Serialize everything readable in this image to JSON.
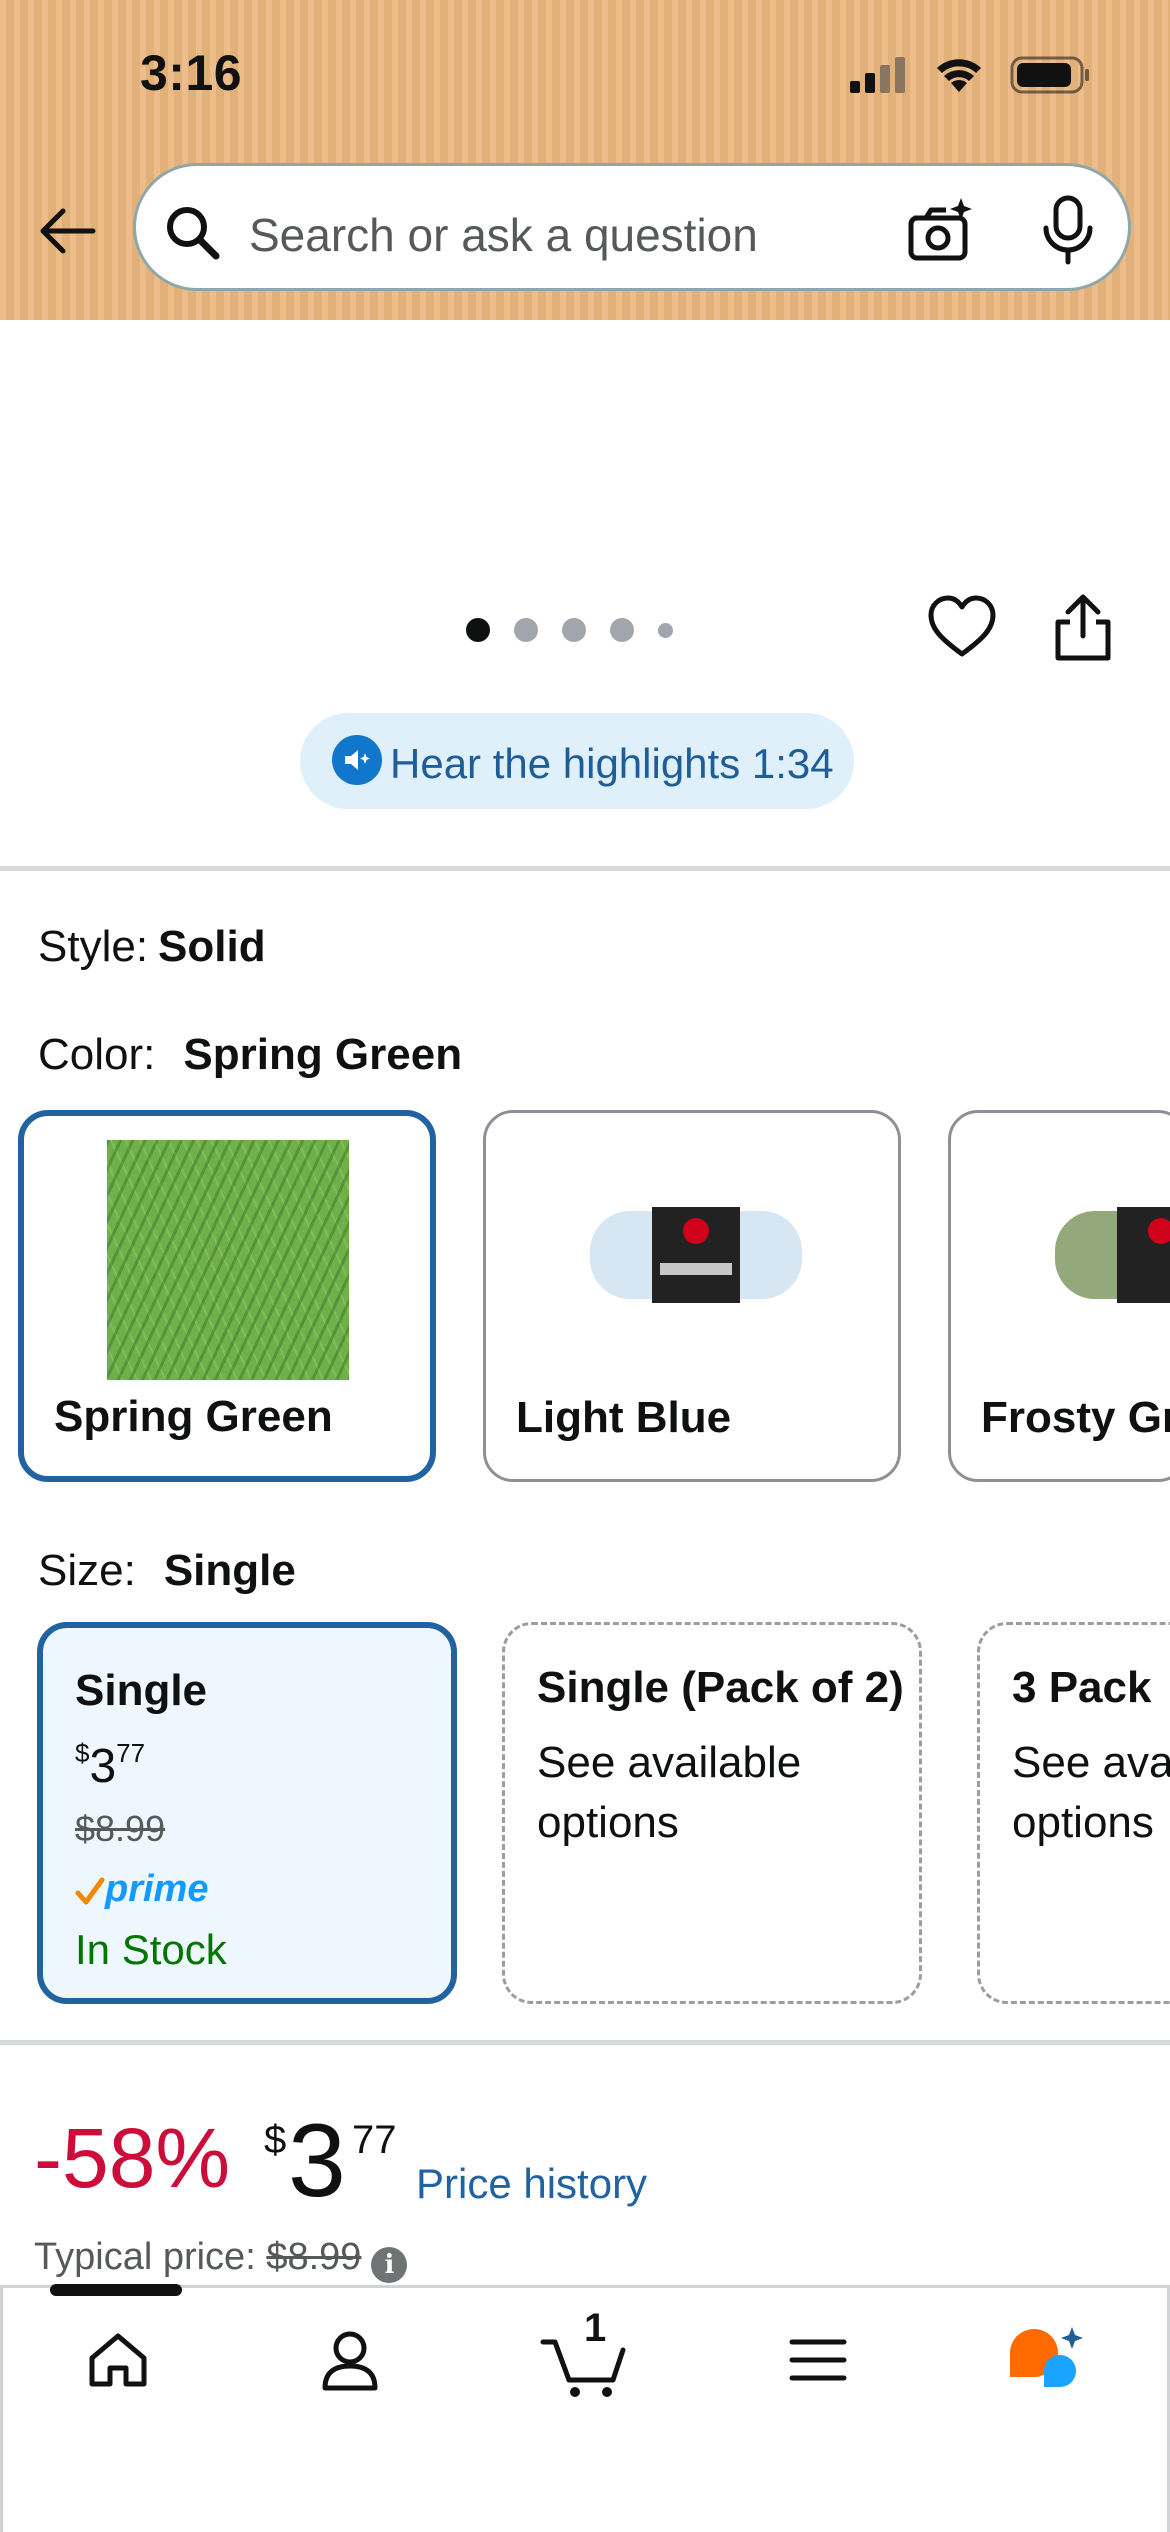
{
  "status_bar": {
    "time": "3:16"
  },
  "search": {
    "placeholder": "Search or ask a question"
  },
  "gallery": {
    "dot_count": 5,
    "active_index": 0
  },
  "highlights": {
    "label": "Hear the highlights 1:34"
  },
  "style": {
    "label": "Style:",
    "value": "Solid"
  },
  "color": {
    "label": "Color:",
    "value": "Spring Green",
    "options": [
      {
        "name": "Spring Green",
        "selected": true,
        "swatch": "#6fb04a"
      },
      {
        "name": "Light Blue",
        "selected": false,
        "swatch": "#d7e6f3"
      },
      {
        "name": "Frosty Gr",
        "selected": false,
        "swatch": "#93a87b"
      }
    ]
  },
  "size": {
    "label": "Size:",
    "value": "Single",
    "options": [
      {
        "title": "Single",
        "currency": "$",
        "price_whole": "3",
        "price_fraction": "77",
        "list_price": "$8.99",
        "prime": "prime",
        "stock": "In Stock",
        "selected": true
      },
      {
        "title": "Single (Pack of 2)",
        "subtitle": "See available options",
        "selected": false
      },
      {
        "title": "3 Pack",
        "subtitle": "See ava options",
        "selected": false
      }
    ]
  },
  "price": {
    "discount": "-58%",
    "currency": "$",
    "whole": "3",
    "fraction": "77",
    "history_link": "Price history",
    "typical_label": "Typical price:",
    "typical_value": "$8.99"
  },
  "tabbar": {
    "cart_count": "1"
  },
  "colors": {
    "accent": "#2162a1",
    "discount": "#cc0c39",
    "in_stock": "#007600",
    "header": "#eab67d",
    "selected_bg": "#edf7fd"
  }
}
